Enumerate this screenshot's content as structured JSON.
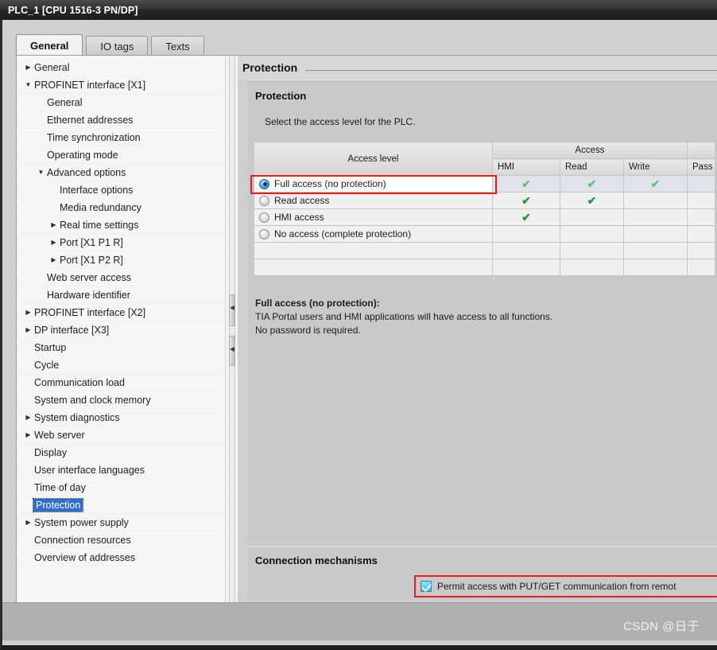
{
  "window": {
    "title": "PLC_1 [CPU 1516-3 PN/DP]"
  },
  "tabs": [
    {
      "label": "General",
      "active": true
    },
    {
      "label": "IO tags",
      "active": false
    },
    {
      "label": "Texts",
      "active": false
    }
  ],
  "nav": {
    "items": [
      {
        "label": "General",
        "indent": 0,
        "arrow": "collapsed",
        "selected": false
      },
      {
        "label": "PROFINET interface [X1]",
        "indent": 0,
        "arrow": "expanded",
        "selected": false
      },
      {
        "label": "General",
        "indent": 1,
        "arrow": "none",
        "selected": false
      },
      {
        "label": "Ethernet addresses",
        "indent": 1,
        "arrow": "none",
        "selected": false
      },
      {
        "label": "Time synchronization",
        "indent": 1,
        "arrow": "none",
        "selected": false
      },
      {
        "label": "Operating mode",
        "indent": 1,
        "arrow": "none",
        "selected": false
      },
      {
        "label": "Advanced options",
        "indent": 1,
        "arrow": "expanded",
        "selected": false
      },
      {
        "label": "Interface options",
        "indent": 2,
        "arrow": "none",
        "selected": false
      },
      {
        "label": "Media redundancy",
        "indent": 2,
        "arrow": "none",
        "selected": false
      },
      {
        "label": "Real time settings",
        "indent": 2,
        "arrow": "collapsed",
        "selected": false
      },
      {
        "label": "Port [X1 P1 R]",
        "indent": 2,
        "arrow": "collapsed",
        "selected": false
      },
      {
        "label": "Port [X1 P2 R]",
        "indent": 2,
        "arrow": "collapsed",
        "selected": false
      },
      {
        "label": "Web server access",
        "indent": 1,
        "arrow": "none",
        "selected": false
      },
      {
        "label": "Hardware identifier",
        "indent": 1,
        "arrow": "none",
        "selected": false
      },
      {
        "label": "PROFINET interface [X2]",
        "indent": 0,
        "arrow": "collapsed",
        "selected": false
      },
      {
        "label": "DP interface [X3]",
        "indent": 0,
        "arrow": "collapsed",
        "selected": false
      },
      {
        "label": "Startup",
        "indent": 0,
        "arrow": "none",
        "selected": false
      },
      {
        "label": "Cycle",
        "indent": 0,
        "arrow": "none",
        "selected": false
      },
      {
        "label": "Communication load",
        "indent": 0,
        "arrow": "none",
        "selected": false
      },
      {
        "label": "System and clock memory",
        "indent": 0,
        "arrow": "none",
        "selected": false
      },
      {
        "label": "System diagnostics",
        "indent": 0,
        "arrow": "collapsed",
        "selected": false
      },
      {
        "label": "Web server",
        "indent": 0,
        "arrow": "collapsed",
        "selected": false
      },
      {
        "label": "Display",
        "indent": 0,
        "arrow": "none",
        "selected": false
      },
      {
        "label": "User interface languages",
        "indent": 0,
        "arrow": "none",
        "selected": false
      },
      {
        "label": "Time of day",
        "indent": 0,
        "arrow": "none",
        "selected": false
      },
      {
        "label": "Protection",
        "indent": 0,
        "arrow": "none",
        "selected": true
      },
      {
        "label": "System power supply",
        "indent": 0,
        "arrow": "collapsed",
        "selected": false
      },
      {
        "label": "Connection resources",
        "indent": 0,
        "arrow": "none",
        "selected": false
      },
      {
        "label": "Overview of addresses",
        "indent": 0,
        "arrow": "none",
        "selected": false
      }
    ]
  },
  "content": {
    "header_title": "Protection",
    "protection": {
      "group_title": "Protection",
      "intro": "Select the access level for the PLC.",
      "table": {
        "header_access_level": "Access level",
        "header_access_group": "Access",
        "subheaders": [
          "HMI",
          "Read",
          "Write",
          "Pass"
        ],
        "rows": [
          {
            "label": "Full access (no protection)",
            "selected": true,
            "hmi": true,
            "read": true,
            "write": true,
            "pass": false
          },
          {
            "label": "Read access",
            "selected": false,
            "hmi": true,
            "read": true,
            "write": false,
            "pass": false
          },
          {
            "label": "HMI access",
            "selected": false,
            "hmi": true,
            "read": false,
            "write": false,
            "pass": false
          },
          {
            "label": "No access (complete protection)",
            "selected": false,
            "hmi": false,
            "read": false,
            "write": false,
            "pass": false
          }
        ],
        "check_glyph": "✔"
      },
      "description_title": "Full access (no protection):",
      "description_line1": "TIA Portal users and HMI applications will have access to all functions.",
      "description_line2": "No password is required."
    },
    "connection": {
      "group_title": "Connection mechanisms",
      "checkbox_label": "Permit access with PUT/GET communication from remot",
      "checkbox_checked": true
    }
  },
  "watermark": "CSDN @日于",
  "colors": {
    "accent_selection": "#2a6fd6",
    "annotation_red": "#ee1c1c",
    "check_green": "#1f9c33",
    "checkbox_blue": "#3bb8e2"
  }
}
